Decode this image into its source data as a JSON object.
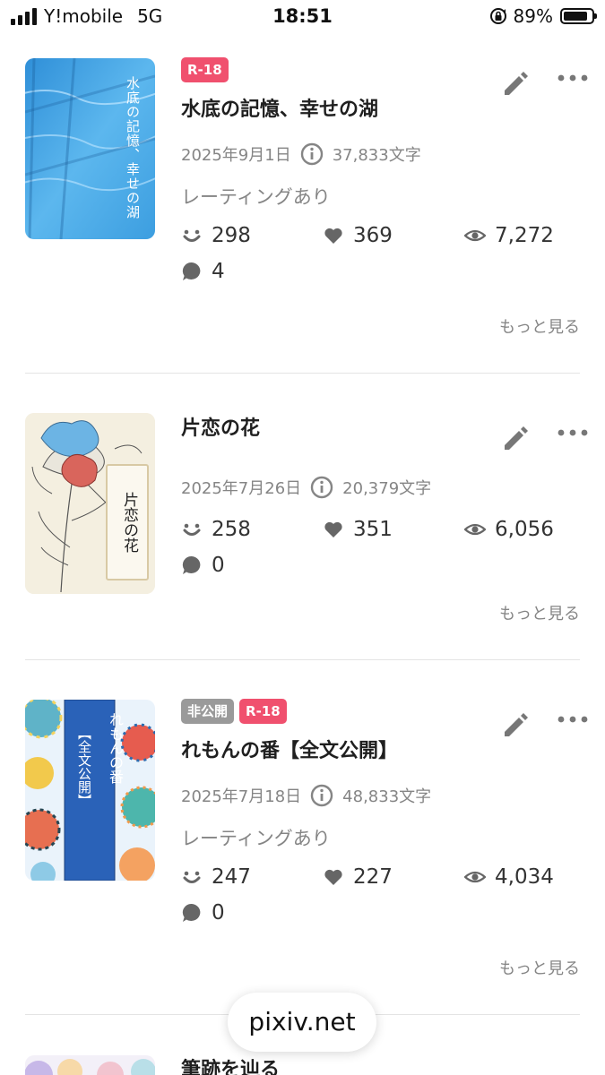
{
  "status_bar": {
    "carrier": "Y!mobile",
    "network": "5G",
    "time": "18:51",
    "battery": "89%"
  },
  "works": [
    {
      "badges": [
        "R-18"
      ],
      "title": "水底の記憶、幸せの湖",
      "date": "2025年9月1日",
      "chars": "37,833文字",
      "rating": "レーティングあり",
      "reactions": "298",
      "likes": "369",
      "views": "7,272",
      "comments": "4",
      "more": "もっと見る",
      "cover_text": "水底の記憶、幸せの湖"
    },
    {
      "badges": [],
      "title": "片恋の花",
      "date": "2025年7月26日",
      "chars": "20,379文字",
      "reactions": "258",
      "likes": "351",
      "views": "6,056",
      "comments": "0",
      "more": "もっと見る",
      "cover_text": "片恋の花"
    },
    {
      "badges": [
        "非公開",
        "R-18"
      ],
      "title": "れもんの番【全文公開】",
      "date": "2025年7月18日",
      "chars": "48,833文字",
      "rating": "レーティングあり",
      "reactions": "247",
      "likes": "227",
      "views": "4,034",
      "comments": "0",
      "more": "もっと見る",
      "cover_text_1": "れもんの番",
      "cover_text_2": "【全文公開】"
    },
    {
      "title": "筆跡を辿る"
    }
  ],
  "footer": {
    "domain": "pixiv.net"
  },
  "colors": {
    "r18_badge": "#f0506e",
    "private_badge": "#9a9a9a",
    "muted_text": "#858585"
  },
  "icons": [
    "signal-icon",
    "rotation-lock-icon",
    "battery-icon",
    "smile-icon",
    "heart-icon",
    "eye-icon",
    "comment-icon",
    "info-icon",
    "pencil-icon",
    "more-dots-icon"
  ]
}
